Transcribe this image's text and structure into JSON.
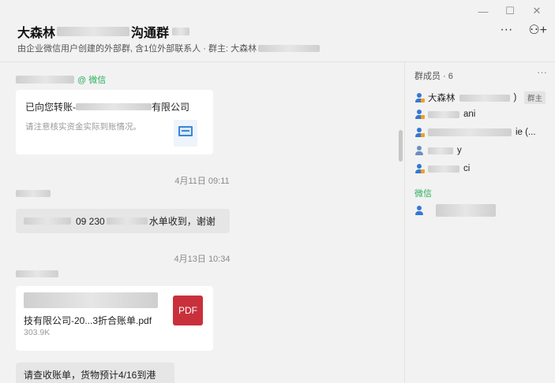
{
  "window": {
    "minimize_icon": "minimize-icon",
    "maximize_icon": "maximize-icon",
    "close_icon": "close-icon"
  },
  "header": {
    "title_prefix": "大森林",
    "title_suffix": "沟通群",
    "subtitle": "由企业微信用户创建的外部群, 含1位外部联系人 · 群主: 大森林",
    "more_label": "···",
    "add_member_label": "⚇+"
  },
  "chat": {
    "msg1": {
      "sender_tag": "@ 微信",
      "card_title_prefix": "已向您转账-",
      "card_title_suffix": "有限公司",
      "card_sub": "请注意核实资金实际到账情况。"
    },
    "ts1": "4月11日 09:11",
    "msg2": {
      "text_a": "09  230",
      "text_b": "水单收到，谢谢"
    },
    "ts2": "4月13日 10:34",
    "msg3": {
      "file_name": "技有限公司-20...3折合账单.pdf",
      "file_size": "303.9K",
      "pdf_label": "PDF"
    },
    "msg4": {
      "text": "请查收账单，货物预计4/16到港"
    }
  },
  "members": {
    "title": "群成员 · 6",
    "more": "···",
    "list": [
      {
        "prefix": "大森林",
        "suffix": ")",
        "badge": "群主"
      },
      {
        "prefix": "",
        "suffix": "ani"
      },
      {
        "prefix": "",
        "suffix": "ie (..."
      },
      {
        "prefix": "",
        "suffix": "y"
      },
      {
        "prefix": "",
        "suffix": "ci"
      }
    ],
    "wechat_section": "微信"
  },
  "colors": {
    "accent_green": "#2fae5f",
    "member_blue": "#3478d4",
    "pdf_red": "#c8313c"
  }
}
